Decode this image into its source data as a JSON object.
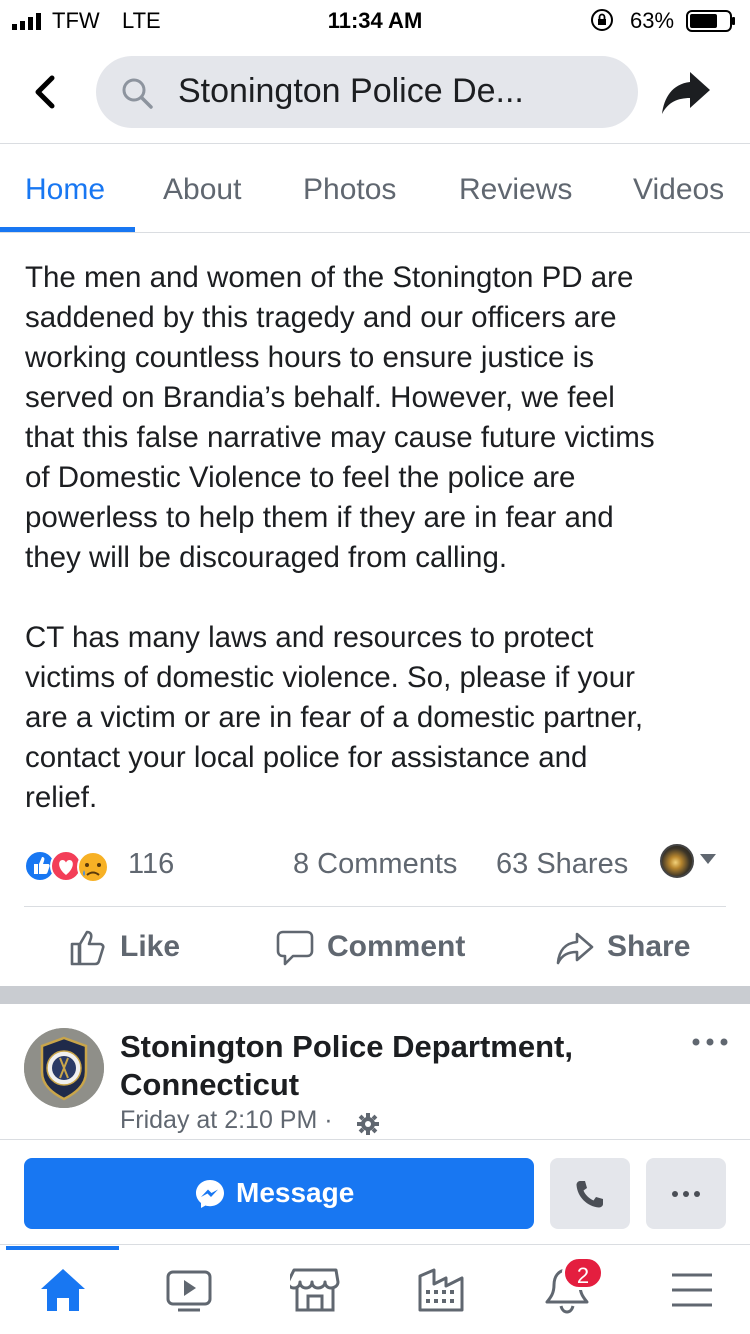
{
  "status_bar": {
    "carrier": "TFW",
    "network": "LTE",
    "time": "11:34 AM",
    "battery_percent": "63%"
  },
  "header": {
    "search_text": "Stonington Police De..."
  },
  "tabs": [
    {
      "label": "Home",
      "active": true
    },
    {
      "label": "About",
      "active": false
    },
    {
      "label": "Photos",
      "active": false
    },
    {
      "label": "Reviews",
      "active": false
    },
    {
      "label": "Videos",
      "active": false
    }
  ],
  "post": {
    "paragraph1": "The men and women of the Stonington PD are\nsaddened by this tragedy and our officers are\nworking countless hours to ensure justice is\nserved on Brandia’s behalf. However, we feel\nthat this false narrative may cause future victims\nof Domestic Violence to feel the police are\npowerless to help them if they are in fear and\nthey will be discouraged from calling.",
    "paragraph2": "CT has many laws and resources to protect\nvictims of domestic violence. So, please if your\nare a victim or are in fear of a domestic partner,\ncontact your local police for assistance and\nrelief.",
    "reaction_count": "116",
    "comments": "8 Comments",
    "shares": "63 Shares",
    "reaction_types": [
      "like",
      "love",
      "sad"
    ]
  },
  "actions": {
    "like": "Like",
    "comment": "Comment",
    "share": "Share"
  },
  "next_post": {
    "page_name": "Stonington Police Department, Connecticut",
    "time": "Friday at 2:10 PM ·"
  },
  "bottom_actions": {
    "message": "Message"
  },
  "bottom_nav": {
    "notification_badge": "2",
    "items": [
      "home-icon",
      "watch-icon",
      "marketplace-icon",
      "pages-icon",
      "notifications-icon",
      "menu-icon"
    ]
  },
  "colors": {
    "accent": "#1877f2",
    "secondary_text": "#606770",
    "badge": "#e41e3f"
  }
}
